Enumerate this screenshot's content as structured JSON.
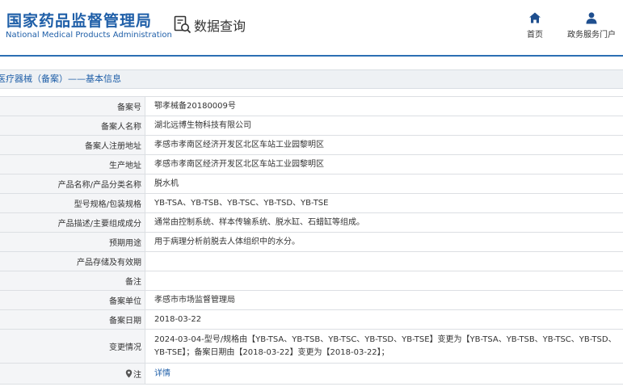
{
  "header": {
    "logo_cn": "国家药品监督管理局",
    "logo_en": "National Medical Products Administration",
    "query_label": "数据查询",
    "nav": [
      {
        "label": "首页",
        "icon": "home-icon"
      },
      {
        "label": "政务服务门户",
        "icon": "user-icon"
      }
    ]
  },
  "section": {
    "title": "医疗器械（备案）——基本信息"
  },
  "table": {
    "rows": [
      {
        "label": "备案号",
        "value": "鄂孝械备20180009号"
      },
      {
        "label": "备案人名称",
        "value": "湖北远博生物科技有限公司"
      },
      {
        "label": "备案人注册地址",
        "value": "孝感市孝南区经济开发区北区车站工业园黎明区"
      },
      {
        "label": "生产地址",
        "value": "孝感市孝南区经济开发区北区车站工业园黎明区"
      },
      {
        "label": "产品名称/产品分类名称",
        "value": "脱水机"
      },
      {
        "label": "型号规格/包装规格",
        "value": "YB-TSA、YB-TSB、YB-TSC、YB-TSD、YB-TSE"
      },
      {
        "label": "产品描述/主要组成成分",
        "value": "通常由控制系统、样本传输系统、脱水缸、石蜡缸等组成。"
      },
      {
        "label": "预期用途",
        "value": "用于病理分析前脱去人体组织中的水分。"
      },
      {
        "label": "产品存储及有效期",
        "value": ""
      },
      {
        "label": "备注",
        "value": ""
      },
      {
        "label": "备案单位",
        "value": "孝感市市场监督管理局"
      },
      {
        "label": "备案日期",
        "value": "2018-03-22"
      },
      {
        "label": "变更情况",
        "value": "2024-03-04-型号/规格由【YB-TSA、YB-TSB、YB-TSC、YB-TSD、YB-TSE】变更为【YB-TSA、YB-TSB、YB-TSC、YB-TSD、YB-TSE】；备案日期由【2018-03-22】变更为【2018-03-22】；"
      },
      {
        "label": "注",
        "value": "详情",
        "icon": "pin-icon"
      }
    ]
  },
  "colors": {
    "brand": "#1f5fa8",
    "header_border": "#2c6fb3",
    "label_bg": "#f4f5f7",
    "section_bg": "#eef1f4"
  }
}
